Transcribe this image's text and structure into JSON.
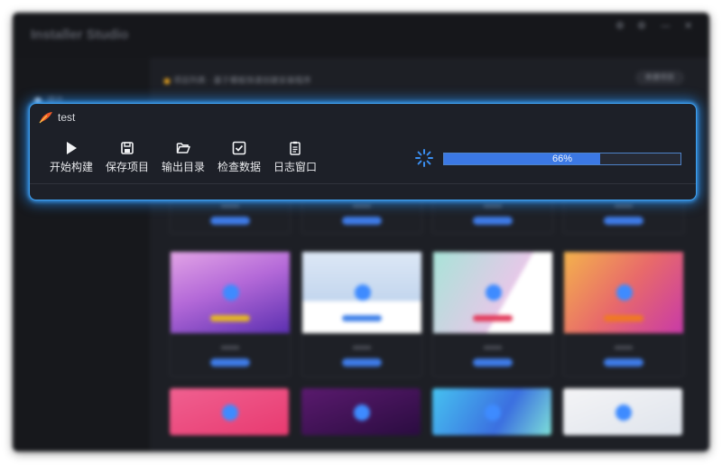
{
  "background_app": {
    "title": "Installer Studio",
    "window_controls": [
      "⚙",
      "⚙",
      "—",
      "✕"
    ],
    "sidebar_item": "设计",
    "notice": "项目列表 · 基于模板快速创建安装程序",
    "header_button": "新建项目"
  },
  "build_panel": {
    "title": "test",
    "accent_color": "#3fa0f0",
    "toolbar": [
      {
        "icon": "play-icon",
        "label": "开始构建"
      },
      {
        "icon": "save-icon",
        "label": "保存项目"
      },
      {
        "icon": "folder-open-icon",
        "label": "输出目录"
      },
      {
        "icon": "checkbox-icon",
        "label": "检查数据"
      },
      {
        "icon": "log-icon",
        "label": "日志窗口"
      }
    ],
    "progress": {
      "value": 0.66,
      "label": "66%",
      "fill_color": "#3b78e4"
    }
  }
}
